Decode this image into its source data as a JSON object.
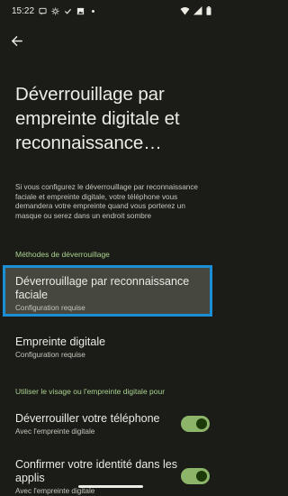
{
  "status_bar": {
    "time": "15:22",
    "icons": [
      "message-icon",
      "settings-icon",
      "check-icon",
      "image-icon",
      "dot-icon",
      "wifi-icon",
      "signal-icon",
      "battery-icon"
    ]
  },
  "header": {
    "back_icon": "arrow-left-icon",
    "title": "Déverrouillage par empreinte digitale et reconnaissance…"
  },
  "intro": "Si vous configurez le déverrouillage par reconnais­sance faciale et empreinte digitale, votre téléphone vous demandera votre empreinte quand vous porterez un masque ou serez dans un endroit sombre",
  "unlock_methods": {
    "header": "Méthodes de déverrouillage",
    "items": [
      {
        "title": "Déverrouillage par reconnaissance faciale",
        "subtitle": "Configuration requise"
      },
      {
        "title": "Empreinte digitale",
        "subtitle": "Configuration requise"
      }
    ]
  },
  "use_section": {
    "header": "Utiliser le visage ou l'empreinte digitale pour",
    "items": [
      {
        "title": "Déverrouiller votre téléphone",
        "subtitle": "Avec l'empreinte digitale",
        "enabled": true
      },
      {
        "title": "Confirmer votre identité dans les applis",
        "subtitle": "Avec l'empreinte digitale",
        "enabled": true
      }
    ]
  },
  "colors": {
    "background": "#1b1c18",
    "accent": "#a9d18d",
    "toggle_on": "#8cb56a",
    "highlight": "#1b8fd6"
  }
}
